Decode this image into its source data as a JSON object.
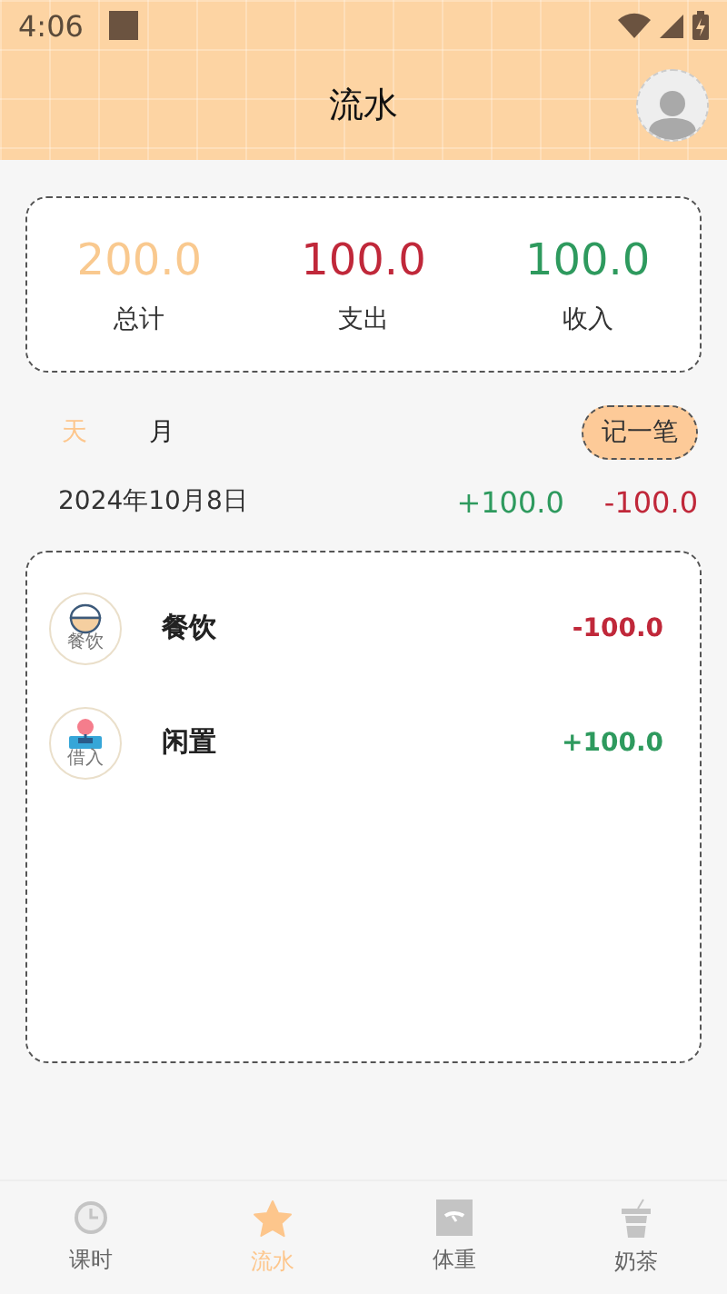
{
  "status_bar": {
    "time": "4:06"
  },
  "header": {
    "title": "流水"
  },
  "summary": [
    {
      "kind": "total",
      "value": "200.0",
      "label": "总计"
    },
    {
      "kind": "expense",
      "value": "100.0",
      "label": "支出"
    },
    {
      "kind": "income",
      "value": "100.0",
      "label": "收入"
    }
  ],
  "tabs": [
    {
      "label": "天",
      "selected": true
    },
    {
      "label": "月",
      "selected": false
    }
  ],
  "add_button": "记一笔",
  "day": {
    "date": "2024年10月8日",
    "totals": [
      {
        "kind": "income",
        "value": "+100.0"
      },
      {
        "kind": "expense",
        "value": "-100.0"
      }
    ]
  },
  "records": [
    {
      "kind": "expense",
      "icon_label": "餐饮",
      "category": "餐饮",
      "amount": "-100.0"
    },
    {
      "kind": "income",
      "icon_label": "借入",
      "category": "闲置",
      "amount": "+100.0"
    }
  ],
  "nav": [
    {
      "label": "课时",
      "selected": false
    },
    {
      "label": "流水",
      "selected": true
    },
    {
      "label": "体重",
      "selected": false
    },
    {
      "label": "奶茶",
      "selected": false
    }
  ]
}
